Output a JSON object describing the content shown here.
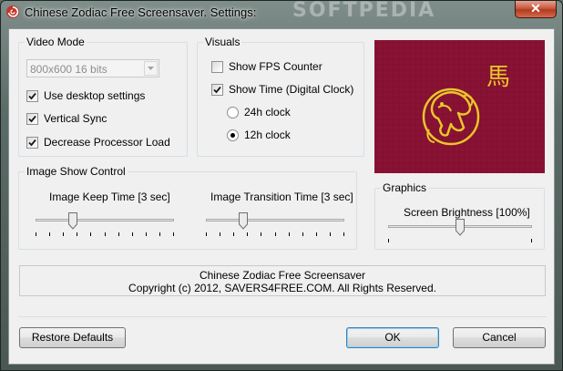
{
  "window": {
    "title": "Chinese Zodiac Free Screensaver. Settings:",
    "watermark": "SOFTPEDIA",
    "close_label": "✕",
    "app_icon": "red-swirl-icon"
  },
  "video_mode": {
    "legend": "Video Mode",
    "resolution": {
      "value": "800x600 16 bits",
      "disabled": true
    },
    "options": [
      {
        "label": "Use desktop settings",
        "checked": true
      },
      {
        "label": "Vertical Sync",
        "checked": true
      },
      {
        "label": "Decrease Processor Load",
        "checked": true
      }
    ]
  },
  "visuals": {
    "legend": "Visuals",
    "show_fps": {
      "label": "Show FPS Counter",
      "checked": false
    },
    "show_time": {
      "label": "Show Time (Digital Clock)",
      "checked": true
    },
    "clock_24h": {
      "label": "24h clock",
      "selected": false
    },
    "clock_12h": {
      "label": "12h clock",
      "selected": true
    }
  },
  "preview": {
    "background_color": "#8a1234",
    "glyph": "馬",
    "accent_color": "#e9c629",
    "icon": "horse-zodiac-icon"
  },
  "image_show": {
    "legend": "Image Show Control",
    "keep_time": {
      "label": "Image Keep Time [3 sec]",
      "level": 0.25
    },
    "transition_time": {
      "label": "Image Transition Time [3 sec]",
      "level": 0.25
    }
  },
  "graphics": {
    "legend": "Graphics",
    "brightness": {
      "label": "Screen Brightness [100%]",
      "level": 0.5
    }
  },
  "about": {
    "line1": "Chinese Zodiac Free Screensaver",
    "line2": "Copyright (c) 2012, SAVERS4FREE.COM. All Rights Reserved."
  },
  "buttons": {
    "restore": "Restore Defaults",
    "ok": "OK",
    "cancel": "Cancel"
  }
}
